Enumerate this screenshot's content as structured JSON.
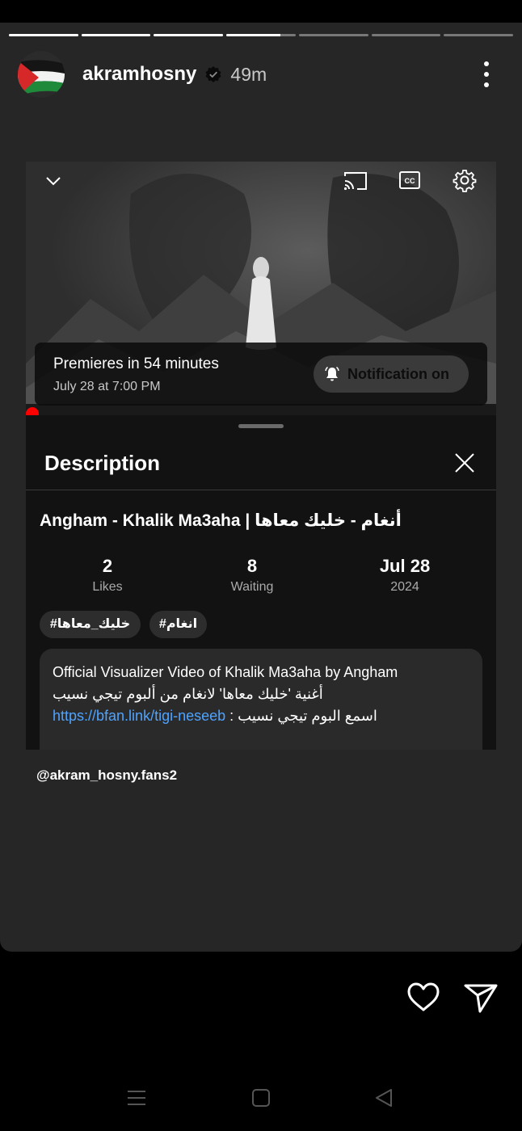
{
  "story": {
    "segments": [
      1,
      1,
      1,
      0.78,
      0,
      0,
      0
    ],
    "username": "akramhosny",
    "time_ago": "49m",
    "caption": "@akram_hosny.fans2"
  },
  "video": {
    "premiere_title": "Premieres in 54 minutes",
    "premiere_date": "July 28 at 7:00 PM",
    "notification_label": "Notification on"
  },
  "description": {
    "heading": "Description",
    "video_title": "Angham - Khalik Ma3aha | أنغام - خليك معاها",
    "stats": [
      {
        "value": "2",
        "label": "Likes"
      },
      {
        "value": "8",
        "label": "Waiting"
      },
      {
        "value": "Jul 28",
        "label": "2024"
      }
    ],
    "hashtags": [
      "#خليك_معاها",
      "#انغام"
    ],
    "body_line1": "Official Visualizer Video of Khalik Ma3aha by Angham",
    "body_line2": "أغنية 'خليك معاها' لانغام من ألبوم تيجي نسيب",
    "body_link": "https://bfan.link/tigi-neseeb",
    "body_line3_suffix": " : اسمع البوم تيجي نسيب"
  },
  "colors": {
    "story_bg": "#262626",
    "link": "#4ea3ff",
    "premiere_dot": "#ff0000"
  }
}
